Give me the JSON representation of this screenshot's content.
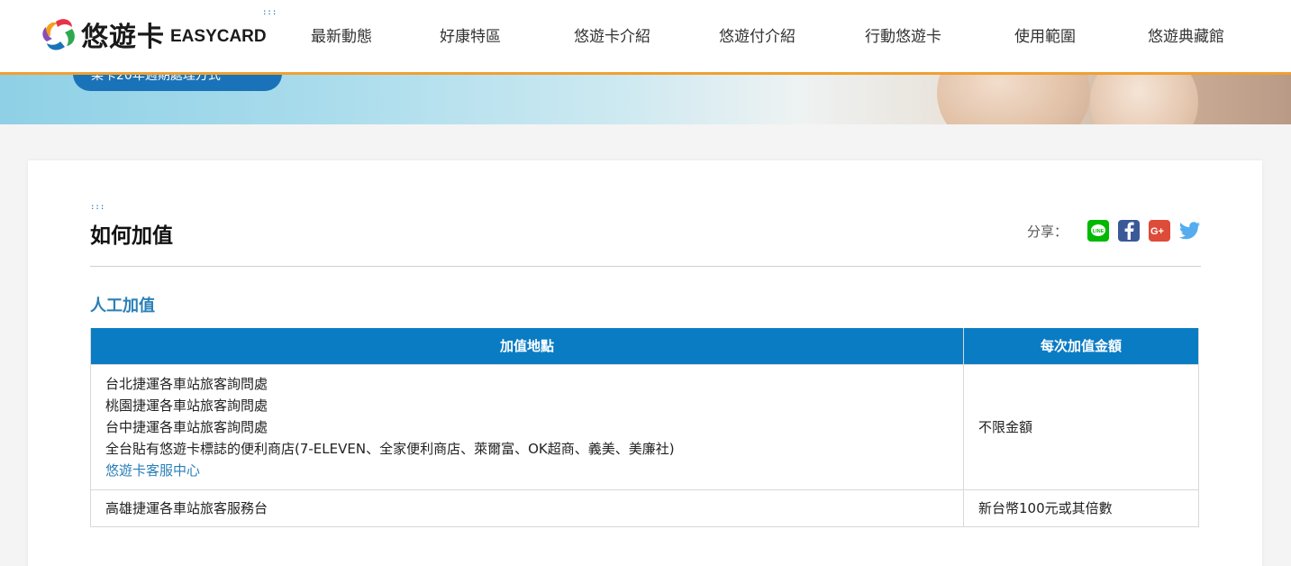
{
  "header": {
    "logo_zh": "悠遊卡",
    "logo_en": "EASYCARD",
    "nav": [
      "最新動態",
      "好康特區",
      "悠遊卡介紹",
      "悠遊付介紹",
      "行動悠遊卡",
      "使用範圍",
      "悠遊典藏館"
    ]
  },
  "hero": {
    "button_text": "某卡20年週期處理方式"
  },
  "main": {
    "title": "如何加值",
    "share_label": "分享：",
    "share_icons": [
      "line-icon",
      "facebook-icon",
      "google-plus-icon",
      "twitter-icon"
    ],
    "section_title": "人工加值",
    "table": {
      "headers": [
        "加值地點",
        "每次加值金額"
      ],
      "rows": [
        {
          "locations": [
            "台北捷運各車站旅客詢問處",
            "桃園捷運各車站旅客詢問處",
            "台中捷運各車站旅客詢問處",
            "全台貼有悠遊卡標誌的便利商店(7-ELEVEN、全家便利商店、萊爾富、OK超商、義美、美廉社)"
          ],
          "link": "悠遊卡客服中心",
          "amount": "不限金額"
        },
        {
          "locations": [
            "高雄捷運各車站旅客服務台"
          ],
          "amount": "新台幣100元或其倍數"
        }
      ]
    }
  },
  "colors": {
    "accent_orange": "#f0a030",
    "table_header": "#0a7cc4",
    "link_blue": "#2a7fb8",
    "line_green": "#00b900",
    "facebook_blue": "#3b5998",
    "google_red": "#dd4b39",
    "twitter_blue": "#55acee"
  }
}
